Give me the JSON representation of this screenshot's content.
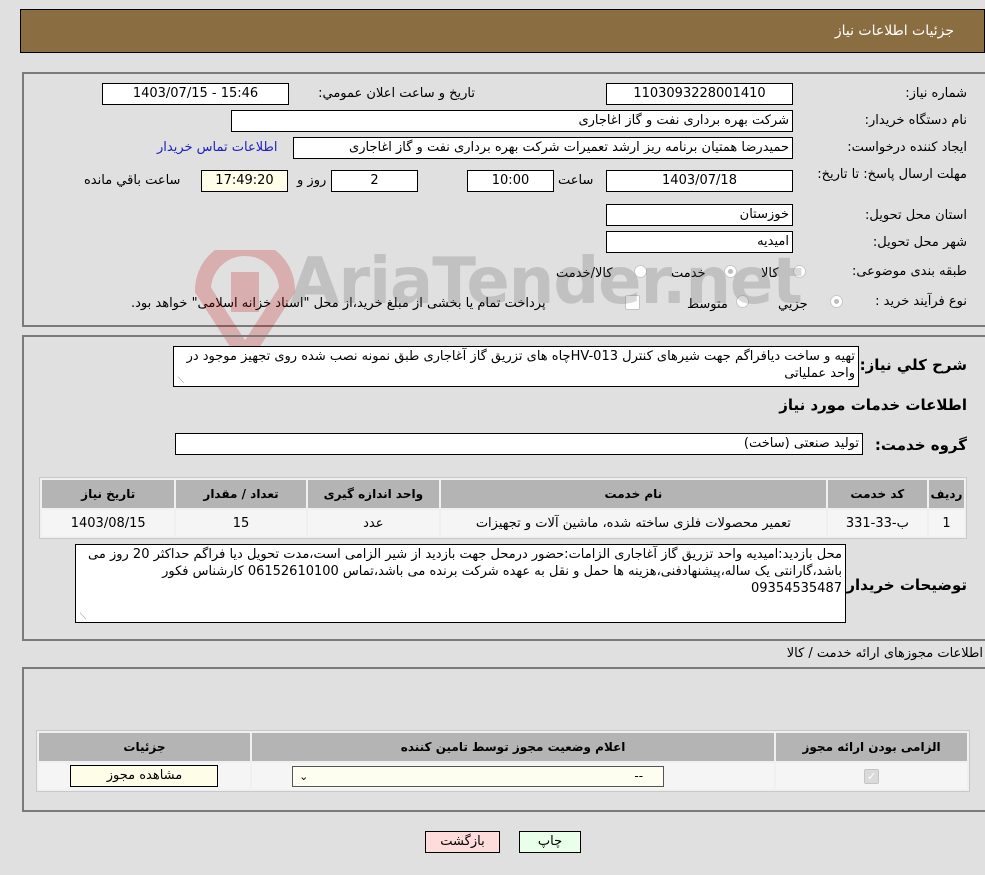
{
  "header": {
    "title": "جزئيات اطلاعات نياز"
  },
  "info": {
    "need_number_label": "شماره نياز:",
    "need_number": "1103093228001410",
    "announce_label": "تاريخ و ساعت اعلان عمومي:",
    "announce_value": "1403/07/15 - 15:46",
    "buyer_org_label": "نام دستگاه خريدار:",
    "buyer_org": "شرکت بهره برداری نفت و گاز اغاجاری",
    "requester_label": "ايجاد کننده درخواست:",
    "requester": "حمیدرضا همتیان برنامه ریز ارشد تعمیرات شرکت بهره برداری نفت و گاز اغاجاری",
    "contact_link": "اطلاعات تماس خريدار",
    "deadline_label": "مهلت ارسال پاسخ: تا تاريخ:",
    "deadline_date": "1403/07/18",
    "time_label": "ساعت",
    "deadline_time": "10:00",
    "days_value": "2",
    "days_label": "روز و",
    "remaining_time": "17:49:20",
    "remaining_label": "ساعت باقي مانده",
    "province_label": "استان محل تحويل:",
    "province": "خوزستان",
    "city_label": "شهر محل تحويل:",
    "city": "امیدیه",
    "category_label": "طبقه بندی موضوعی:",
    "category_options": [
      {
        "label": "کالا",
        "selected": false
      },
      {
        "label": "خدمت",
        "selected": true
      },
      {
        "label": "کالا/خدمت",
        "selected": false
      }
    ],
    "process_label": "نوع فرآيند خريد :",
    "process_options": [
      {
        "label": "جزيي",
        "selected": true
      },
      {
        "label": "متوسط",
        "selected": false
      }
    ],
    "payment_note": "پرداخت تمام يا بخشی از مبلغ خريد،از محل \"اسناد خزانه اسلامی\" خواهد بود."
  },
  "description": {
    "label": "شرح کلي نياز:",
    "text": "تهیه و ساخت دیافراگم جهت شیرهای کنترل HV-013چاه های تزریق گاز آغاجاری طبق نمونه نصب شده روی تجهیز موجود در واحد عملیاتی",
    "services_title": "اطلاعات خدمات مورد نياز",
    "service_group_label": "گروه خدمت:",
    "service_group": "تولید صنعتی (ساخت)"
  },
  "services_table": {
    "headers": [
      "رديف",
      "کد خدمت",
      "نام خدمت",
      "واحد اندازه گيری",
      "تعداد / مقدار",
      "تاريخ نياز"
    ],
    "rows": [
      [
        "1",
        "ب-33-331",
        "تعمیر محصولات فلزی ساخته شده، ماشین آلات و تجهیزات",
        "عدد",
        "15",
        "1403/08/15"
      ]
    ]
  },
  "buyer_notes": {
    "label": "توضيحات خريدار:",
    "text": "محل بازدید:امیدیه واحد تزریق گاز آغاجاری الزامات:حضور درمحل جهت بازدید از شیر الزامی است،مدت تحویل دیا فراگم حداکثر  20 روز می باشد،گارانتی یک ساله،پیشنهادفنی،هزینه ها حمل و نقل به عهده شرکت برنده می باشد،تماس 06152610100 کارشناس فکور 09354535487"
  },
  "permits": {
    "title": "اطلاعات مجوزهای ارائه خدمت / کالا",
    "headers": [
      "الزامی بودن ارائه مجوز",
      "اعلام وضعيت مجوز توسط تامين کننده",
      "جزئيات"
    ],
    "row": {
      "required_checked": true,
      "status_value": "--",
      "details_button": "مشاهده مجوز"
    }
  },
  "buttons": {
    "print": "چاپ",
    "back": "بازگشت"
  },
  "watermark": {
    "text": "AriaTender.net"
  }
}
